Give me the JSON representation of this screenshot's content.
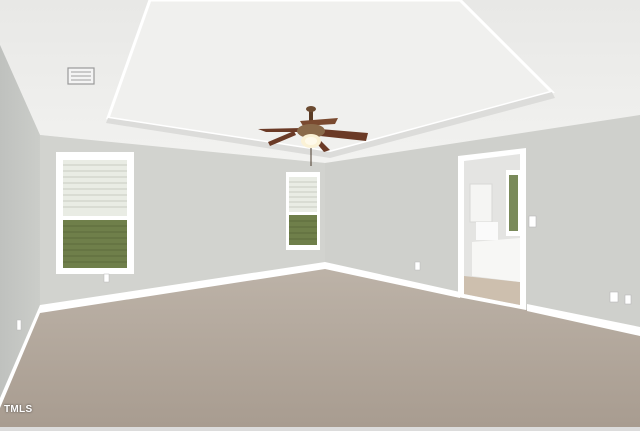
{
  "photo": {
    "subject": "empty-bedroom",
    "fixtures": [
      "tray-ceiling",
      "ceiling-fan-with-light",
      "hvac-vent",
      "two-windows-with-blinds",
      "carpet-floor",
      "white-baseboards",
      "doorway-to-bathroom",
      "wall-outlets",
      "light-switch"
    ],
    "colors": {
      "wall_left": "#c7c9c6",
      "wall_back": "#d3d4d0",
      "wall_right": "#cfd0cc",
      "ceiling": "#ececea",
      "tray_inner": "#f1f1ef",
      "carpet": "#b3a89c",
      "trim": "#ffffff",
      "window_glass": "#7a8a5a",
      "fan_blade": "#6b3a26",
      "fan_body": "#8a6a4a"
    }
  },
  "watermark": {
    "text": "TMLS"
  }
}
